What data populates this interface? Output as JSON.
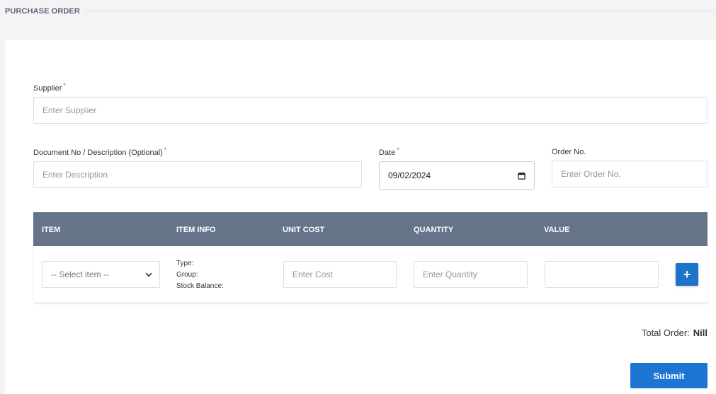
{
  "page": {
    "title": "PURCHASE ORDER"
  },
  "form": {
    "supplier": {
      "label": "Supplier",
      "required_mark": "*",
      "placeholder": "Enter Supplier",
      "value": ""
    },
    "description": {
      "label": "Document No / Description (Optional)",
      "required_mark": "*",
      "placeholder": "Enter Description",
      "value": ""
    },
    "date": {
      "label": "Date",
      "required_mark": "*",
      "value": "09/02/2024",
      "icon": "calendar-icon"
    },
    "order_no": {
      "label": "Order No.",
      "placeholder": "Enter Order No.",
      "value": ""
    }
  },
  "table": {
    "headers": [
      "ITEM",
      "ITEM INFO",
      "UNIT COST",
      "QUANTITY",
      "VALUE"
    ],
    "row": {
      "item_select": "-- Select item --",
      "info": {
        "type": "Type:",
        "group": "Group:",
        "stock": "Stock Balance:"
      },
      "cost_placeholder": "Enter Cost",
      "qty_placeholder": "Enter Quantity",
      "value": "",
      "add_icon": "plus-icon",
      "add_symbol": "+"
    }
  },
  "summary": {
    "total_label": "Total Order:",
    "total_value": "Nill"
  },
  "actions": {
    "submit_label": "Submit"
  },
  "colors": {
    "accent": "#1d74d3",
    "table_header": "#667489",
    "required": "#e0454a"
  }
}
